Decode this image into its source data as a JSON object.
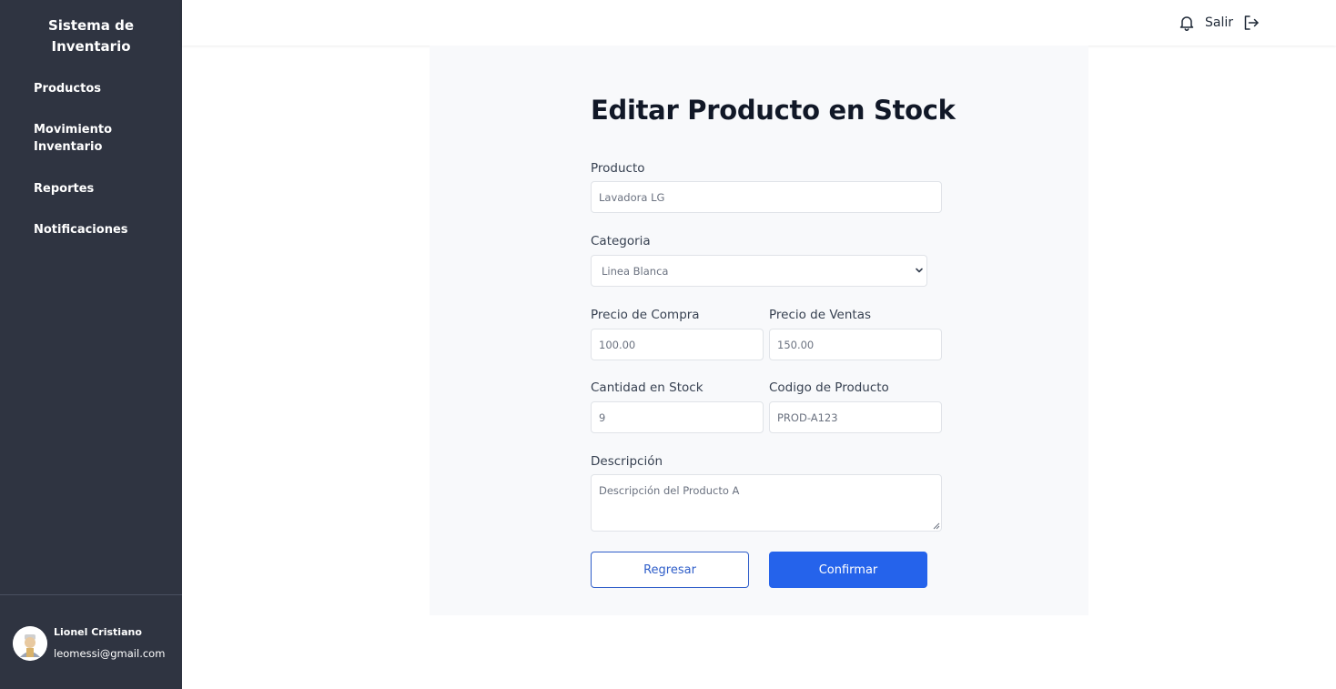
{
  "sidebar": {
    "brand": "Sistema de Inventario",
    "items": [
      {
        "label": "Productos"
      },
      {
        "label": "Movimiento Inventario"
      },
      {
        "label": "Reportes"
      },
      {
        "label": "Notificaciones"
      }
    ],
    "user": {
      "name": "Lionel Cristiano",
      "email": "leomessi@gmail.com"
    }
  },
  "topbar": {
    "notifications_icon": "bell-icon",
    "logout_label": "Salir",
    "logout_icon": "logout-icon"
  },
  "form": {
    "title": "Editar Producto en Stock",
    "producto": {
      "label": "Producto",
      "value": "Lavadora LG"
    },
    "categoria": {
      "label": "Categoria",
      "selected": "Linea Blanca"
    },
    "precio_compra": {
      "label": "Precio de Compra",
      "value": "100.00"
    },
    "precio_venta": {
      "label": "Precio de Ventas",
      "value": "150.00"
    },
    "cantidad": {
      "label": "Cantidad en Stock",
      "value": "9"
    },
    "codigo": {
      "label": "Codigo de Producto",
      "value": "PROD-A123"
    },
    "descripcion": {
      "label": "Descripción",
      "value": "Descripción del Producto A"
    },
    "back_label": "Regresar",
    "confirm_label": "Confirmar"
  },
  "colors": {
    "sidebar_bg": "#2f3441",
    "primary": "#2563eb",
    "card_bg": "#f8f9fb"
  }
}
